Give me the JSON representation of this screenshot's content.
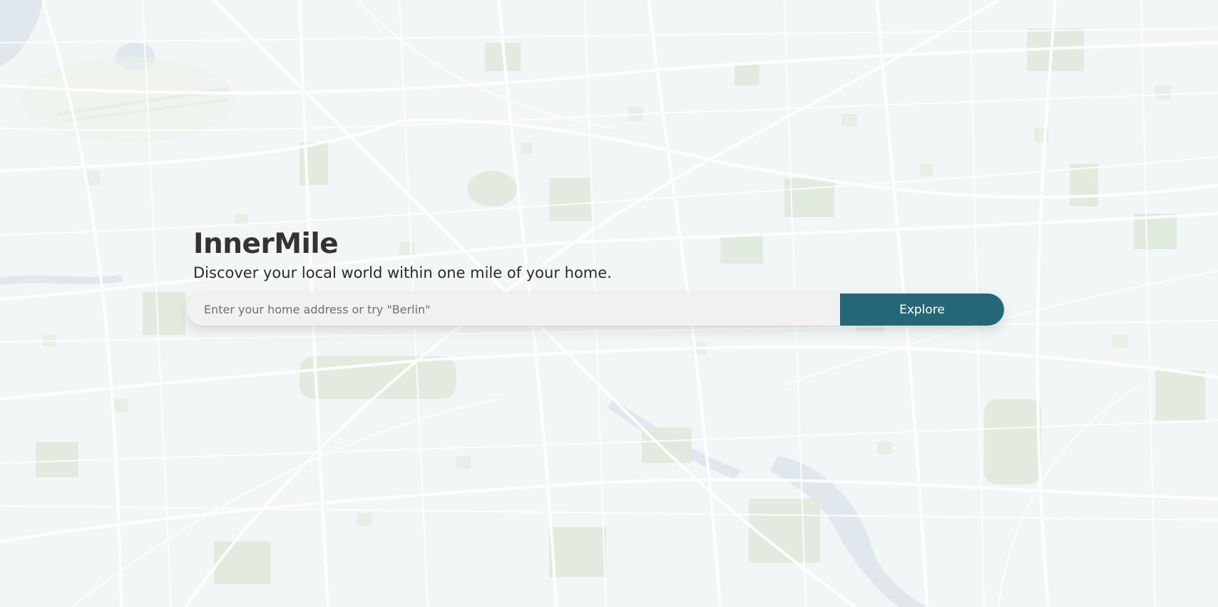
{
  "app": {
    "title": "InnerMile",
    "tagline": "Discover your local world within one mile of your home."
  },
  "search": {
    "placeholder": "Enter your home address or try \"Berlin\"",
    "value": "",
    "button_label": "Explore"
  },
  "colors": {
    "accent": "#256776",
    "title_text": "#333333",
    "map_background": "#f3f6f6",
    "map_park": "#dfe9dc",
    "map_water": "#d9e4ec",
    "map_road": "#ffffff"
  },
  "icons": {
    "background": "city-map"
  }
}
